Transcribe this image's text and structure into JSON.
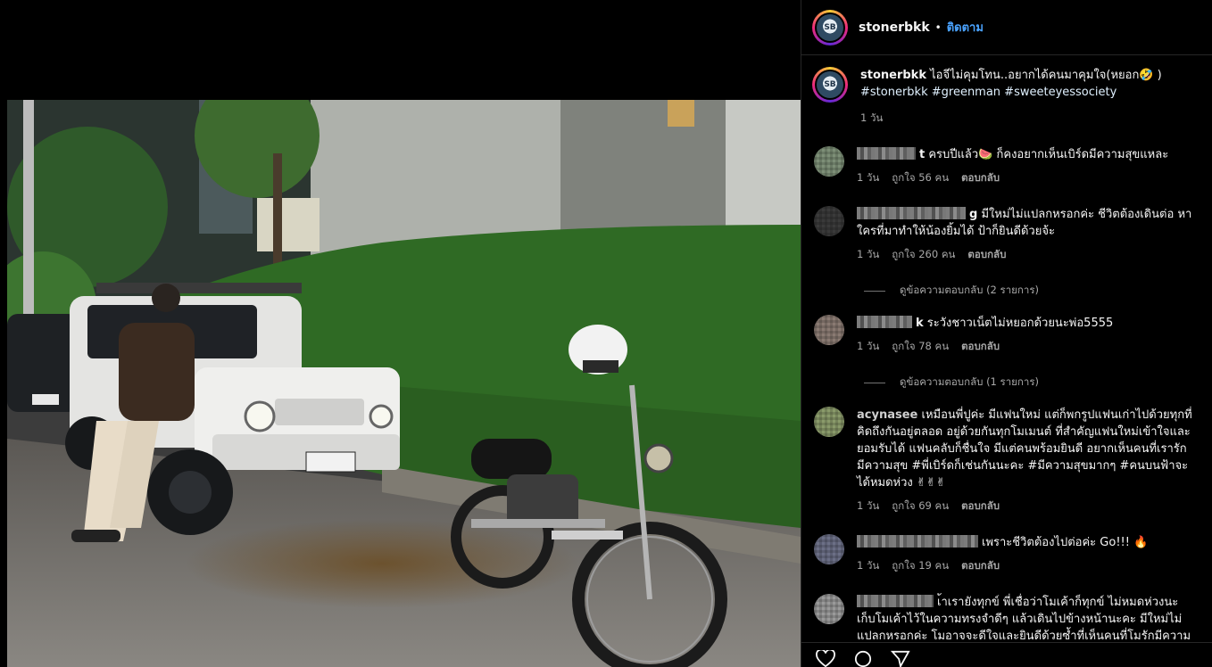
{
  "post": {
    "username": "stonerbkk",
    "follow_label": "ติดตาม",
    "dot": "•",
    "avatar_text": "SB",
    "caption_text": "ไอจีไม่คุมโทน..อยากได้คนมาคุมใจ(หยอก🤣 )",
    "hashtags": "#stonerbkk #greenman #sweeteyessociety",
    "caption_time": "1 วัน"
  },
  "comments": [
    {
      "name_suffix": "t",
      "text": "ครบปีแล้ว🍉 ก็คงอยากเห็นเบิร์ดมีความสุขแหละ",
      "time": "1 วัน",
      "likes": "ถูกใจ 56 คน",
      "reply": "ตอบกลับ",
      "avatar_color": "#7d8f77"
    },
    {
      "name_suffix": "g",
      "text": "มีใหม่ไม่แปลกหรอกค่ะ ชีวิตต้องเดินต่อ หาใครที่มาทำให้น้องยิ้มได้ ป้าก็ยินดีด้วยจ้ะ",
      "time": "1 วัน",
      "likes": "ถูกใจ 260 คน",
      "reply": "ตอบกลับ",
      "avatar_color": "#3a3a3a",
      "view_replies": "ดูข้อความตอบกลับ (2 รายการ)"
    },
    {
      "name_suffix": "k",
      "text": "ระวังชาวเน็ตไม่หยอกด้วยนะพ่อ5555",
      "time": "1 วัน",
      "likes": "ถูกใจ 78 คน",
      "reply": "ตอบกลับ",
      "avatar_color": "#8a7a72",
      "view_replies": "ดูข้อความตอบกลับ (1 รายการ)"
    },
    {
      "name_suffix": "acynasee",
      "text": "เหมือนพี่ปูค่ะ มีแฟนใหม่ แต่ก็พกรูปแฟนเก่าไปด้วยทุกที่ คิดถึงกันอยู่ตลอด อยู่ด้วยกันทุกโมเมนต์ ที่สำคัญแฟนใหม่เข้าใจและยอมรับได้ แฟนคลับก็ชื่นใจ มีแต่คนพร้อมยินดี อยากเห็นคนที่เรารักมีความสุข #พี่เบิร์ดก็เช่นกันนะคะ #มีความสุขมากๆ #คนบนฟ้าจะได้หมดห่วง ✌✌✌",
      "time": "1 วัน",
      "likes": "ถูกใจ 69 คน",
      "reply": "ตอบกลับ",
      "avatar_color": "#8a9a6a"
    },
    {
      "name_suffix": "",
      "text": "เพราะชีวิตต้องไปต่อค่ะ Go!!! 🔥",
      "time": "1 วัน",
      "likes": "ถูกใจ 19 คน",
      "reply": "ตอบกลับ",
      "avatar_color": "#6b6f86"
    },
    {
      "name_suffix": "",
      "text": "เ้าเรายังทุกข์ พี่เชื่อว่าโมเค้าก็ทุกข์ ไม่หมดห่วงนะ เก็บโมเค้าไว้ในความทรงจำดีๆ แล้วเดินไปข้างหน้านะคะ มีใหม่ไม่แปลกหรอกค่ะ โมอาจจะดีใจและยินดีด้วยซ้ำที่เห็นคนที่โมรักมีความสุขนะ",
      "time": "",
      "likes": "",
      "reply": "",
      "avatar_color": "#9a9a9a"
    }
  ],
  "colors": {
    "accent": "#4aa3ff",
    "meta": "#a8a8a8",
    "bg": "#000000"
  },
  "icons": [
    "heart-icon",
    "comment-icon",
    "share-icon"
  ]
}
